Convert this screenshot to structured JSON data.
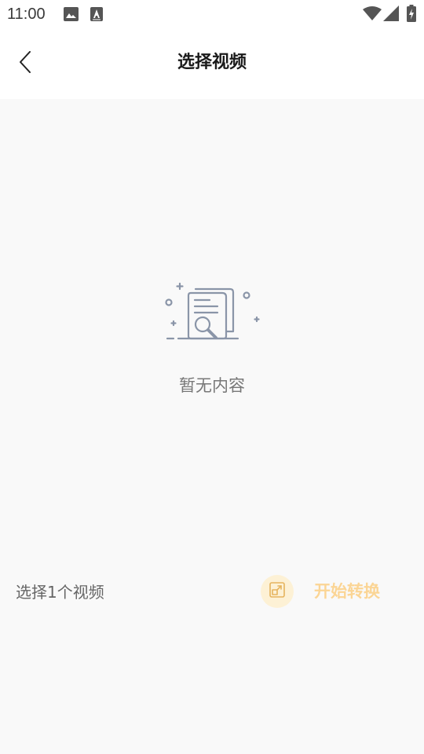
{
  "status_bar": {
    "time": "11:00",
    "left_icons": [
      "image-icon",
      "font-app-icon"
    ],
    "right_icons": [
      "wifi-icon",
      "signal-icon",
      "battery-charging-icon"
    ]
  },
  "header": {
    "title": "选择视频",
    "back_icon": "chevron-left-icon"
  },
  "empty_state": {
    "icon": "document-search-icon",
    "message": "暂无内容"
  },
  "footer_bar": {
    "selection_label": "选择1个视频",
    "convert_icon": "expand-box-icon",
    "convert_label": "开始转换",
    "accent_color": "#fbd595"
  }
}
